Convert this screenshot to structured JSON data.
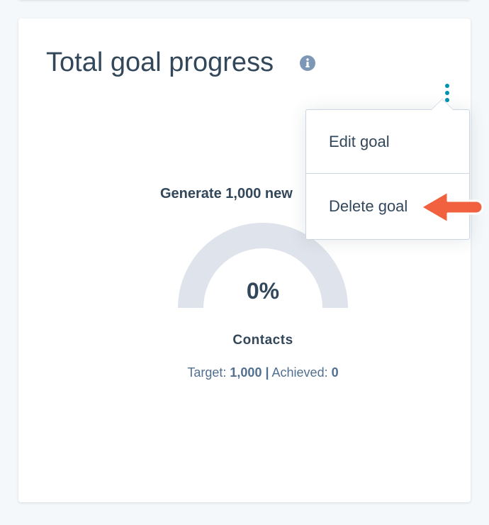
{
  "card": {
    "title": "Total goal progress",
    "info_icon": "info-icon",
    "menu_icon": "kebab-menu-icon"
  },
  "goal": {
    "name": "Generate 1,000 new",
    "progress_percent": "0%",
    "progress_value": 0,
    "metric": "Contacts",
    "target_label": "Target:",
    "target_value": "1,000",
    "separator": "|",
    "achieved_label": "Achieved:",
    "achieved_value": "0"
  },
  "menu": {
    "items": [
      {
        "label": "Edit goal"
      },
      {
        "label": "Delete goal"
      }
    ]
  },
  "colors": {
    "accent": "#0091ae",
    "text": "#33475b",
    "gauge_track": "#dfe3eb",
    "annotation_arrow": "#f2613f"
  }
}
